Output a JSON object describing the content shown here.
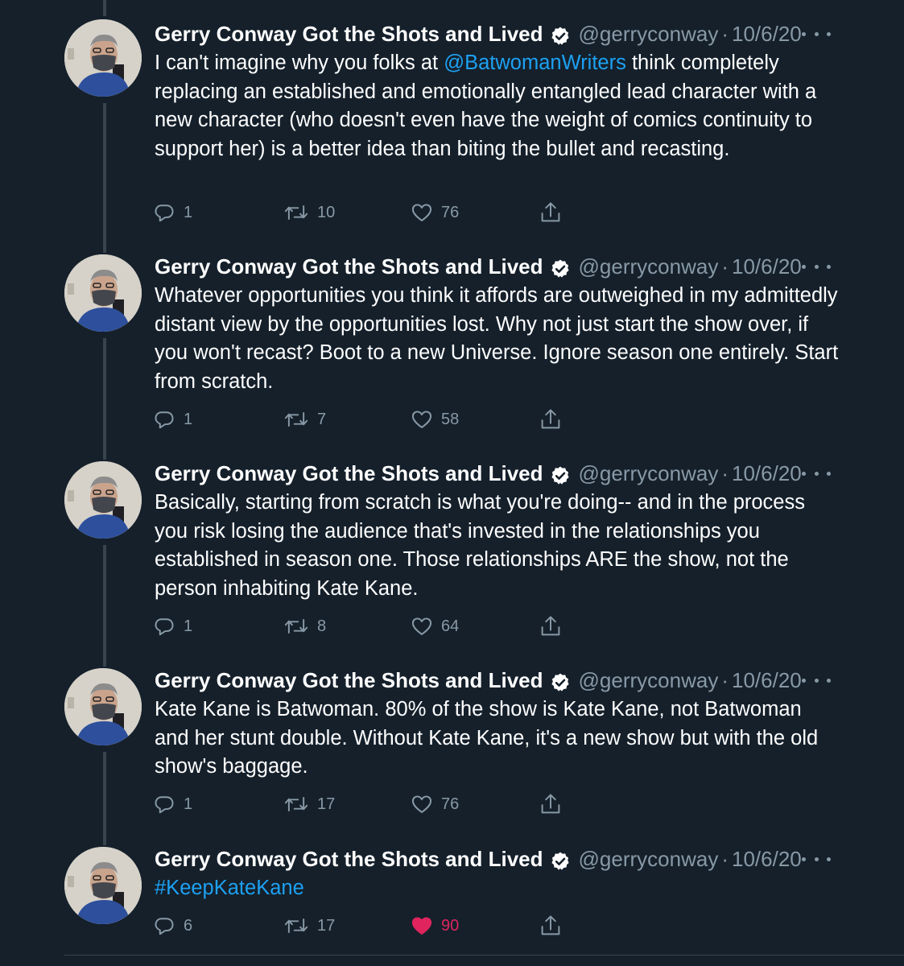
{
  "tweets": [
    {
      "name": "Gerry Conway Got the Shots and Lived",
      "handle": "@gerryconway",
      "separator": "·",
      "date": "10/6/20",
      "text_pre": "I can't imagine why you folks at ",
      "mention": "@BatwomanWriters",
      "text_post": " think completely replacing an established and emotionally entangled lead character with a new character (who doesn't even have the weight of comics continuity to support her) is a better idea than biting the bullet and recasting.",
      "replies": "1",
      "retweets": "10",
      "likes": "76"
    },
    {
      "name": "Gerry Conway Got the Shots and Lived",
      "handle": "@gerryconway",
      "separator": "·",
      "date": "10/6/20",
      "text": "Whatever opportunities you think it affords are outweighed in my admittedly distant view by the opportunities lost. Why not just start the show over, if you won't recast? Boot to a new Universe. Ignore season one entirely. Start from scratch.",
      "replies": "1",
      "retweets": "7",
      "likes": "58"
    },
    {
      "name": "Gerry Conway Got the Shots and Lived",
      "handle": "@gerryconway",
      "separator": "·",
      "date": "10/6/20",
      "text": "Basically, starting from scratch is what you're doing-- and in the process you risk losing the audience that's invested in the relationships you established in season one. Those relationships ARE the show, not the person inhabiting Kate Kane.",
      "replies": "1",
      "retweets": "8",
      "likes": "64"
    },
    {
      "name": "Gerry Conway Got the Shots and Lived",
      "handle": "@gerryconway",
      "separator": "·",
      "date": "10/6/20",
      "text": "Kate Kane is Batwoman. 80% of the show is Kate Kane, not Batwoman and her stunt double. Without Kate Kane, it's a new show but with the old show's baggage.",
      "replies": "1",
      "retweets": "17",
      "likes": "76"
    },
    {
      "name": "Gerry Conway Got the Shots and Lived",
      "handle": "@gerryconway",
      "separator": "·",
      "date": "10/6/20",
      "hashtag": "#KeepKateKane",
      "replies": "6",
      "retweets": "17",
      "likes": "90",
      "liked": true
    }
  ],
  "icons": {
    "verified": "verified-badge-icon",
    "more": "more-icon",
    "reply": "reply-icon",
    "retweet": "retweet-icon",
    "like": "like-icon",
    "share": "share-icon"
  },
  "colors": {
    "background": "#15202b",
    "text": "#ffffff",
    "secondary": "#8899a6",
    "link": "#1da1f2",
    "like_active": "#e0245e",
    "thread_line": "#38444d"
  }
}
